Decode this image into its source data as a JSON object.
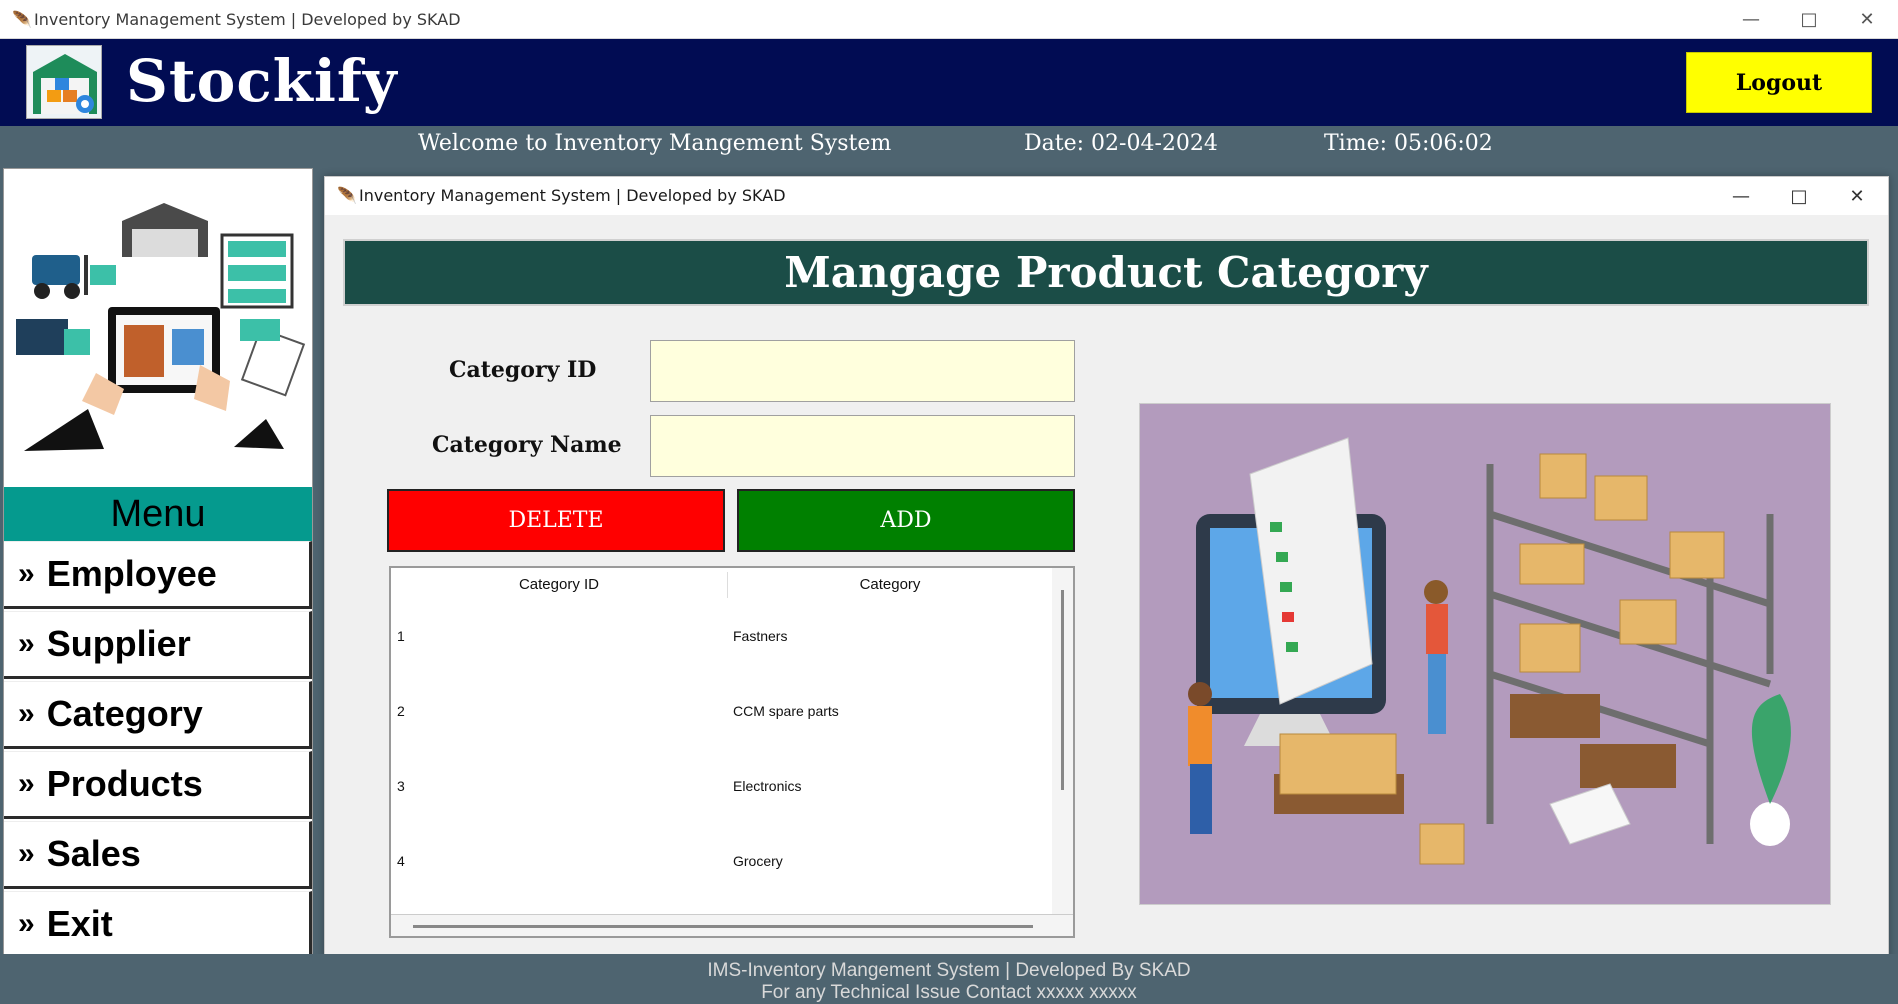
{
  "window": {
    "title": "Inventory Management System | Developed by SKAD",
    "minimize_icon": "minimize-icon",
    "maximize_icon": "maximize-icon",
    "close_icon": "close-icon"
  },
  "header": {
    "app_name": "Stockify",
    "logout_label": "Logout",
    "colors": {
      "background": "#010c53",
      "logout": "#ffff00"
    }
  },
  "infobar": {
    "welcome": "Welcome to Inventory Mangement System",
    "date": "Date: 02-04-2024",
    "time": "Time: 05:06:02"
  },
  "sidebar": {
    "menu_title": "Menu",
    "items": [
      {
        "label": "Employee"
      },
      {
        "label": "Supplier"
      },
      {
        "label": "Category"
      },
      {
        "label": "Products"
      },
      {
        "label": "Sales"
      },
      {
        "label": "Exit"
      }
    ]
  },
  "dialog": {
    "title": "Inventory Management System | Developed by SKAD",
    "heading": "Mangage Product Category",
    "form": {
      "category_id_label": "Category ID",
      "category_id_value": "",
      "category_name_label": "Category Name",
      "category_name_value": ""
    },
    "buttons": {
      "delete": "DELETE",
      "add": "ADD"
    },
    "table": {
      "columns": [
        "Category ID",
        "Category"
      ],
      "rows": [
        [
          "1",
          "Fastners"
        ],
        [
          "2",
          "CCM spare parts"
        ],
        [
          "3",
          "Electronics"
        ],
        [
          "4",
          "Grocery"
        ]
      ]
    }
  },
  "footer": {
    "line1": "IMS-Inventory Mangement System | Developed By SKAD",
    "line2": "For any Technical Issue Contact xxxxx xxxxx"
  }
}
